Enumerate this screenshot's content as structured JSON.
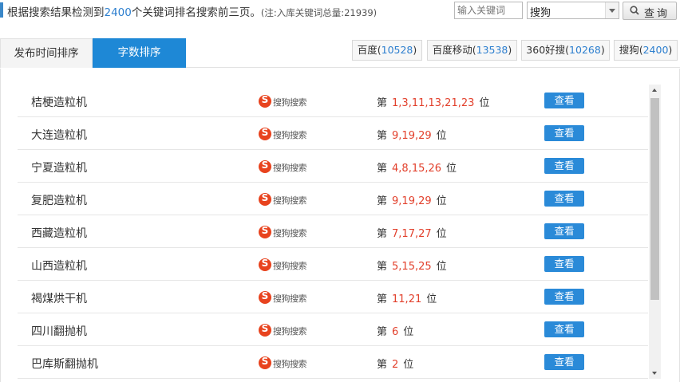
{
  "summary": {
    "prefix": "根据搜索结果检测到",
    "count": "2400",
    "suffix": "个关键词排名搜索前三页。",
    "note": "(注:入库关键词总量:21939)"
  },
  "search": {
    "placeholder": "输入关键词",
    "engine_selected": "搜狗",
    "query_label": "查询"
  },
  "tabs": {
    "publish_time": "发布时间排序",
    "word_count": "字数排序"
  },
  "engine_tabs": [
    {
      "name": "百度",
      "count": "10528"
    },
    {
      "name": "百度移动",
      "count": "13538"
    },
    {
      "name": "360好搜",
      "count": "10268"
    },
    {
      "name": "搜狗",
      "count": "2400"
    }
  ],
  "engine_brand_text": "搜狗搜索",
  "rank_prefix": "第",
  "rank_suffix": "位",
  "view_label": "查看",
  "rows": [
    {
      "keyword": "桔梗造粒机",
      "positions": "1,3,11,13,21,23"
    },
    {
      "keyword": "大连造粒机",
      "positions": "9,19,29"
    },
    {
      "keyword": "宁夏造粒机",
      "positions": "4,8,15,26"
    },
    {
      "keyword": "复肥造粒机",
      "positions": "9,19,29"
    },
    {
      "keyword": "西藏造粒机",
      "positions": "7,17,27"
    },
    {
      "keyword": "山西造粒机",
      "positions": "5,15,25"
    },
    {
      "keyword": "褐煤烘干机",
      "positions": "11,21"
    },
    {
      "keyword": "四川翻抛机",
      "positions": "6"
    },
    {
      "keyword": "巴库斯翻抛机",
      "positions": "2"
    }
  ],
  "colors": {
    "accent": "#1e88d6",
    "count_blue": "#2d7fcf",
    "rank_red": "#e2402c",
    "sogou_red": "#e8431e"
  }
}
